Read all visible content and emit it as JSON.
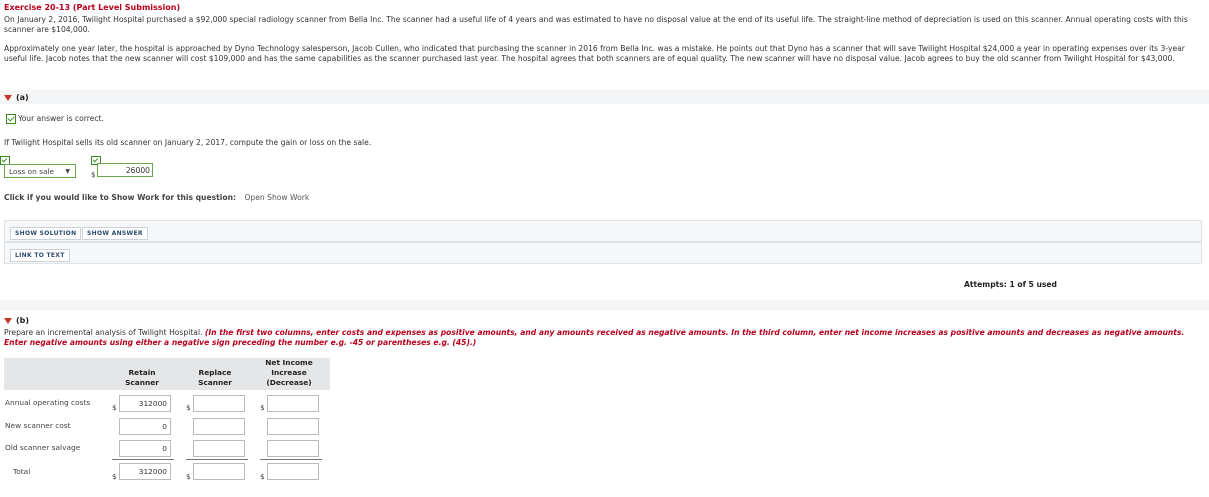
{
  "exercise_title": "Exercise 20-13 (Part Level Submission)",
  "intro_p1": "On January 2, 2016, Twilight Hospital purchased a $92,000 special radiology scanner from Bella Inc. The scanner had a useful life of 4 years and was estimated to have no disposal value at the end of its useful life. The straight-line method of depreciation is used on this scanner. Annual operating costs with this scanner are $104,000.",
  "intro_p2": "Approximately one year later, the hospital is approached by Dyno Technology salesperson, Jacob Cullen, who indicated that purchasing the scanner in 2016 from Bella Inc. was a mistake. He points out that Dyno has a scanner that will save Twilight Hospital $24,000 a year in operating expenses over its 3-year useful life. Jacob notes that the new scanner will cost $109,000 and has the same capabilities as the scanner purchased last year. The hospital agrees that both scanners are of equal quality. The new scanner will have no disposal value. Jacob agrees to buy the old scanner from Twilight Hospital for $43,000.",
  "part_a": {
    "label": "(a)",
    "correct_message": "Your answer is correct.",
    "question": "If Twilight Hospital sells its old scanner on January 2, 2017, compute the gain or loss on the sale.",
    "select_value": "Loss on sale",
    "currency": "$",
    "answer_value": "26000",
    "show_work_prompt": "Click if you would like to Show Work for this question:",
    "show_work_link": "Open Show Work",
    "btn_show_solution": "SHOW SOLUTION",
    "btn_show_answer": "SHOW ANSWER",
    "btn_link_to_text": "LINK TO TEXT",
    "attempts": "Attempts: 1 of 5 used"
  },
  "part_b": {
    "label": "(b)",
    "instruction_plain": "Prepare an incremental analysis of Twilight Hospital.",
    "instruction_italic": "(In the first two columns, enter costs and expenses as positive amounts, and any amounts received as negative amounts.  In the third column, enter net income increases as positive amounts and decreases as negative amounts. Enter negative amounts using either a negative sign preceding the number e.g. -45 or parentheses e.g. (45).)",
    "columns": [
      {
        "line1": "Retain",
        "line2": "Scanner",
        "line3": ""
      },
      {
        "line1": "Replace",
        "line2": "Scanner",
        "line3": ""
      },
      {
        "line1": "Net Income",
        "line2": "Increase",
        "line3": "(Decrease)"
      }
    ],
    "currency": "$",
    "rows": [
      {
        "label": "Annual operating costs",
        "values": [
          "312000",
          "",
          ""
        ]
      },
      {
        "label": "New scanner cost",
        "values": [
          "0",
          "",
          ""
        ]
      },
      {
        "label": "Old scanner salvage",
        "values": [
          "0",
          "",
          ""
        ]
      },
      {
        "label": "Total",
        "values": [
          "312000",
          "",
          ""
        ]
      }
    ]
  }
}
